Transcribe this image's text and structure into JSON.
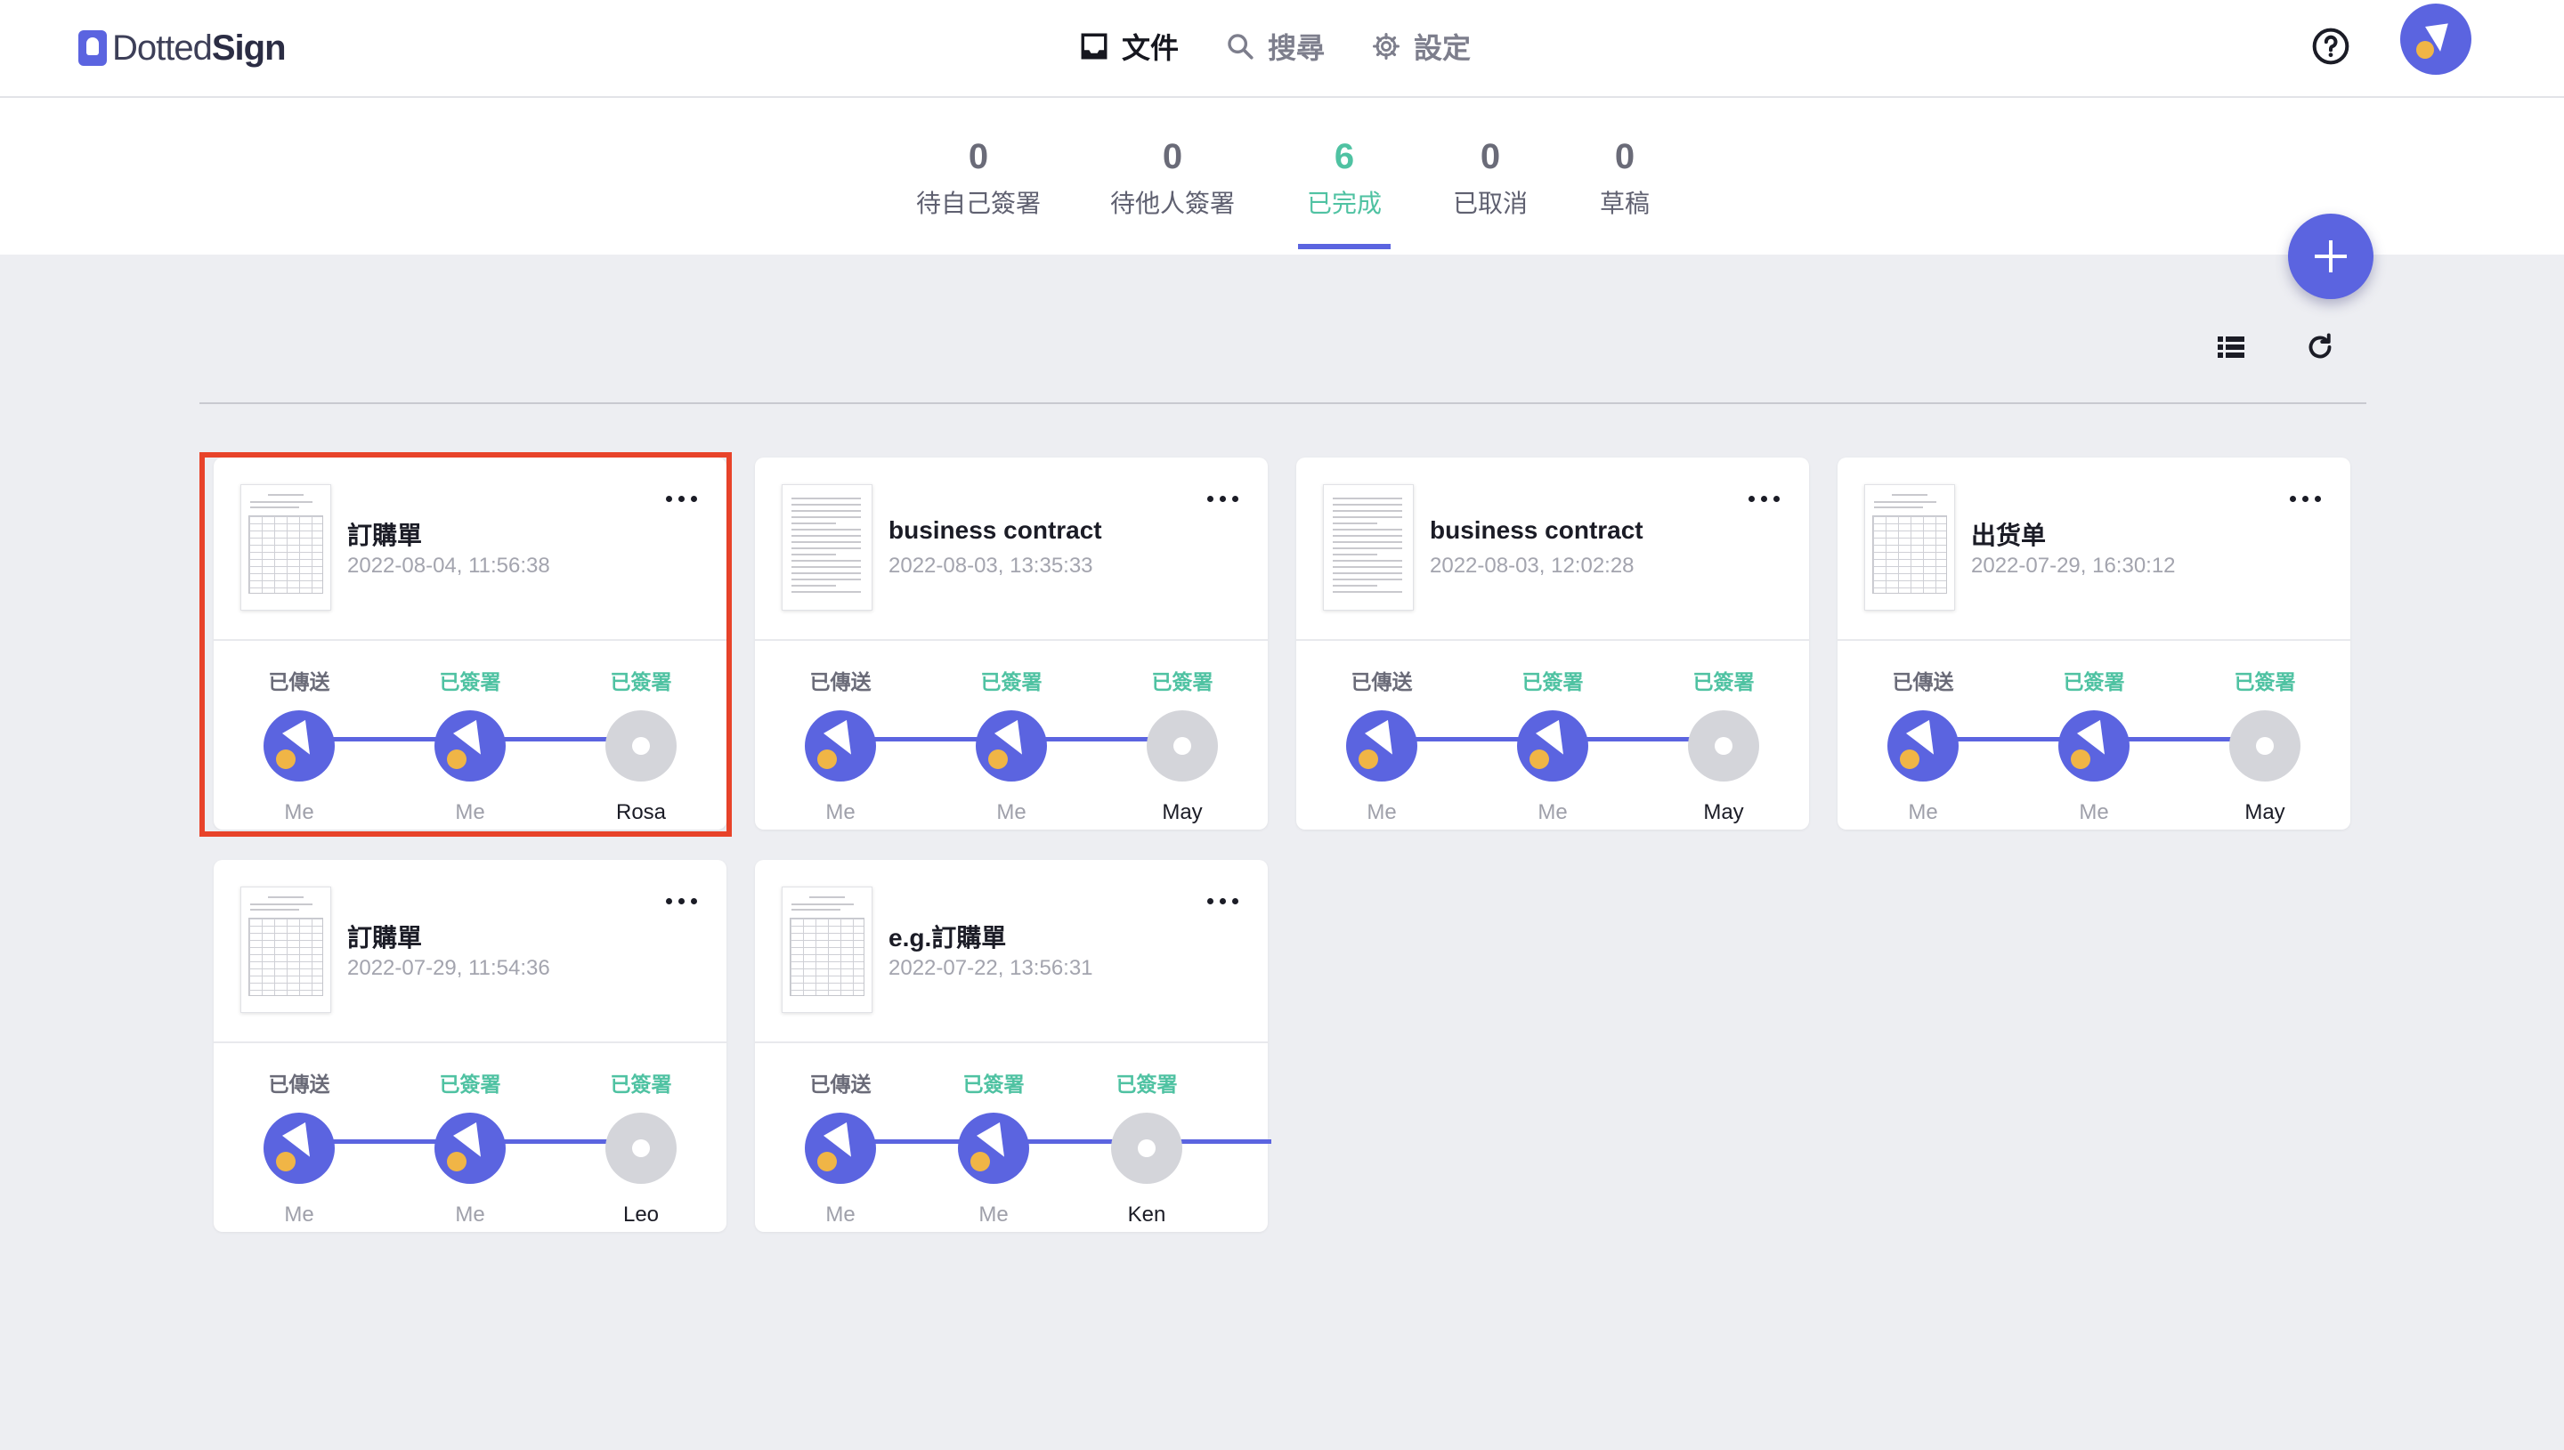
{
  "header": {
    "logo_prefix": "Dotted",
    "logo_suffix": "Sign",
    "nav": [
      {
        "label": "文件",
        "icon": "inbox-icon",
        "active": true
      },
      {
        "label": "搜尋",
        "icon": "search-icon",
        "active": false
      },
      {
        "label": "設定",
        "icon": "gear-icon",
        "active": false
      }
    ]
  },
  "tabs": [
    {
      "count": "0",
      "label": "待自己簽署"
    },
    {
      "count": "0",
      "label": "待他人簽署"
    },
    {
      "count": "6",
      "label": "已完成"
    },
    {
      "count": "0",
      "label": "已取消"
    },
    {
      "count": "0",
      "label": "草稿"
    }
  ],
  "colors": {
    "accent": "#5b64e0",
    "success": "#4fc2a2",
    "highlight": "#e8432a",
    "avatar_dot": "#f0b546"
  },
  "cards": [
    {
      "title": "訂購單",
      "date": "2022-08-04, 11:56:38",
      "thumb": "form",
      "steps": [
        {
          "status": "已傳送",
          "who": "Me"
        },
        {
          "status": "已簽署",
          "who": "Me"
        },
        {
          "status": "已簽署",
          "who": "Rosa"
        }
      ]
    },
    {
      "title": "business contract",
      "date": "2022-08-03, 13:35:33",
      "thumb": "text",
      "steps": [
        {
          "status": "已傳送",
          "who": "Me"
        },
        {
          "status": "已簽署",
          "who": "Me"
        },
        {
          "status": "已簽署",
          "who": "May"
        }
      ]
    },
    {
      "title": "business contract",
      "date": "2022-08-03, 12:02:28",
      "thumb": "text",
      "steps": [
        {
          "status": "已傳送",
          "who": "Me"
        },
        {
          "status": "已簽署",
          "who": "Me"
        },
        {
          "status": "已簽署",
          "who": "May"
        }
      ]
    },
    {
      "title": "出货单",
      "date": "2022-07-29, 16:30:12",
      "thumb": "form",
      "steps": [
        {
          "status": "已傳送",
          "who": "Me"
        },
        {
          "status": "已簽署",
          "who": "Me"
        },
        {
          "status": "已簽署",
          "who": "May"
        }
      ]
    },
    {
      "title": "訂購單",
      "date": "2022-07-29, 11:54:36",
      "thumb": "form",
      "steps": [
        {
          "status": "已傳送",
          "who": "Me"
        },
        {
          "status": "已簽署",
          "who": "Me"
        },
        {
          "status": "已簽署",
          "who": "Leo"
        }
      ]
    },
    {
      "title": "e.g.訂購單",
      "date": "2022-07-22, 13:56:31",
      "thumb": "form",
      "steps": [
        {
          "status": "已傳送",
          "who": "Me"
        },
        {
          "status": "已簽署",
          "who": "Me"
        },
        {
          "status": "已簽署",
          "who": "Ken"
        }
      ]
    }
  ]
}
